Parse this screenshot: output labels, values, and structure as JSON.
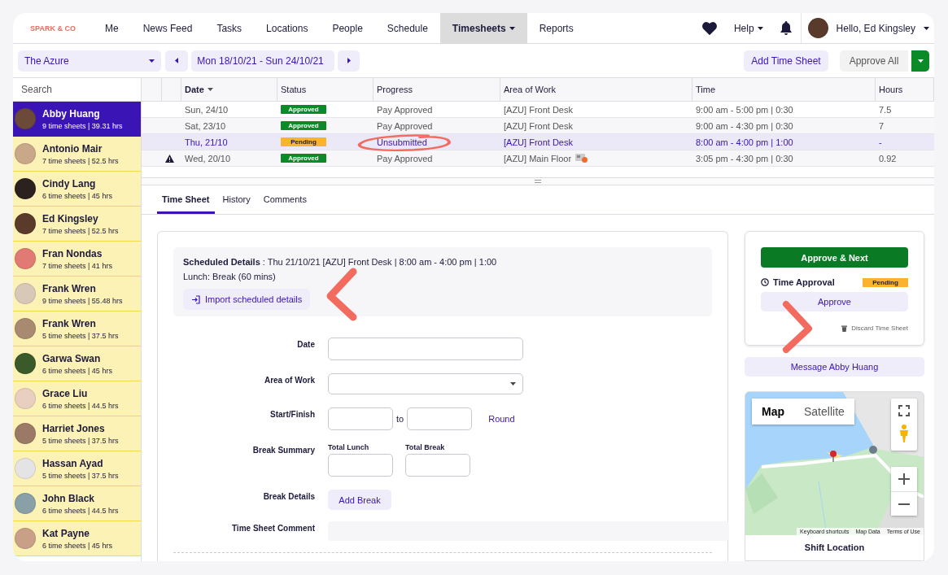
{
  "brand": "SPARK & CO",
  "nav": [
    {
      "label": "Me",
      "selected": false,
      "dropdown": false
    },
    {
      "label": "News Feed",
      "selected": false,
      "dropdown": false
    },
    {
      "label": "Tasks",
      "selected": false,
      "dropdown": false
    },
    {
      "label": "Locations",
      "selected": false,
      "dropdown": false
    },
    {
      "label": "People",
      "selected": false,
      "dropdown": false
    },
    {
      "label": "Schedule",
      "selected": false,
      "dropdown": false
    },
    {
      "label": "Timesheets",
      "selected": true,
      "dropdown": true
    },
    {
      "label": "Reports",
      "selected": false,
      "dropdown": false
    }
  ],
  "help": "Help",
  "user": "Hello, Ed Kingsley",
  "location_select": "The Azure",
  "week_range": "Mon 18/10/21 - Sun 24/10/21",
  "add_button": "Add Time Sheet",
  "approve_all": "Approve All",
  "sidebar": {
    "search_placeholder": "Search",
    "people": [
      {
        "name": "Abby Huang",
        "summary": "9 time sheets | 39.31 hrs",
        "selected": true,
        "color": "#6b4a3a"
      },
      {
        "name": "Antonio Mair",
        "summary": "7 time sheets | 52.5 hrs",
        "selected": false,
        "color": "#c9a88a"
      },
      {
        "name": "Cindy Lang",
        "summary": "6 time sheets | 45 hrs",
        "selected": false,
        "color": "#2b2220"
      },
      {
        "name": "Ed Kingsley",
        "summary": "7 time sheets | 52.5 hrs",
        "selected": false,
        "color": "#5a3a2a"
      },
      {
        "name": "Fran Nondas",
        "summary": "7 time sheets | 41 hrs",
        "selected": false,
        "color": "#e07a72"
      },
      {
        "name": "Frank Wren",
        "summary": "9 time sheets | 55.48 hrs",
        "selected": false,
        "color": "#d8c8b8"
      },
      {
        "name": "Frank Wren",
        "summary": "5 time sheets | 37.5 hrs",
        "selected": false,
        "color": "#a88a70"
      },
      {
        "name": "Garwa Swan",
        "summary": "6 time sheets | 45 hrs",
        "selected": false,
        "color": "#3a5a2a"
      },
      {
        "name": "Grace Liu",
        "summary": "6 time sheets | 44.5 hrs",
        "selected": false,
        "color": "#e8cfc0"
      },
      {
        "name": "Harriet Jones",
        "summary": "5 time sheets | 37.5 hrs",
        "selected": false,
        "color": "#9a7a66"
      },
      {
        "name": "Hassan Ayad",
        "summary": "5 time sheets | 37.5 hrs",
        "selected": false,
        "color": "#e4e4e4"
      },
      {
        "name": "John Black",
        "summary": "6 time sheets | 44.5 hrs",
        "selected": false,
        "color": "#8aa0a8"
      },
      {
        "name": "Kat Payne",
        "summary": "6 time sheets | 45 hrs",
        "selected": false,
        "color": "#c8a088"
      }
    ]
  },
  "table": {
    "columns": [
      "Date",
      "Status",
      "Progress",
      "Area of Work",
      "Time",
      "Hours"
    ],
    "rows": [
      {
        "date": "Sun, 24/10",
        "status": "Approved",
        "kind": "approved",
        "progress": "Pay Approved",
        "area": "[AZU] Front Desk",
        "attachment": false,
        "time": "9:00 am - 5:00 pm | 0:30",
        "hours": "7.5",
        "selected": false,
        "warning": false
      },
      {
        "date": "Sat, 23/10",
        "status": "Approved",
        "kind": "approved",
        "progress": "Pay Approved",
        "area": "[AZU] Front Desk",
        "attachment": false,
        "time": "9:00 am - 4:30 pm | 0:30",
        "hours": "7",
        "selected": false,
        "warning": false
      },
      {
        "date": "Thu, 21/10",
        "status": "Pending",
        "kind": "pending",
        "progress": "Unsubmitted",
        "area": "[AZU] Front Desk",
        "attachment": false,
        "time": "8:00 am - 4:00 pm | 1:00",
        "hours": "-",
        "selected": true,
        "warning": false
      },
      {
        "date": "Wed, 20/10",
        "status": "Approved",
        "kind": "approved",
        "progress": "Pay Approved",
        "area": "[AZU] Main Floor",
        "attachment": true,
        "time": "3:05 pm - 4:30 pm | 0:30",
        "hours": "0.92",
        "selected": false,
        "warning": true
      }
    ]
  },
  "detail_tabs": [
    {
      "label": "Time Sheet",
      "selected": true
    },
    {
      "label": "History",
      "selected": false
    },
    {
      "label": "Comments",
      "selected": false
    }
  ],
  "scheduled": {
    "details": "**Scheduled Details** : Thu 21/10/21 [AZU] Front Desk | 8:00 am - 4:00 pm | 1:00",
    "lunch": "Lunch: Break (60 mins)",
    "import_button": "Import scheduled details"
  },
  "form": {
    "date_label": "Date",
    "area_label": "Area of Work",
    "start_label": "Start/Finish",
    "to": "to",
    "round": "Round",
    "break_summary_label": "Break Summary",
    "total_lunch": "Total Lunch",
    "total_break": "Total Break",
    "break_details_label": "Break Details",
    "add_break": "Add Break",
    "comment_label": "Time Sheet Comment"
  },
  "approval": {
    "approve_next": "Approve & Next",
    "title": "Time Approval",
    "status": "Pending",
    "approve": "Approve",
    "discard": "Discard Time Sheet"
  },
  "message_button": "Message Abby Huang",
  "map": {
    "types": [
      {
        "label": "Map",
        "selected": true
      },
      {
        "label": "Satellite",
        "selected": false
      }
    ],
    "footer": [
      "Keyboard shortcuts",
      "Map Data",
      "Terms of Use"
    ],
    "caption": "Shift Location"
  }
}
